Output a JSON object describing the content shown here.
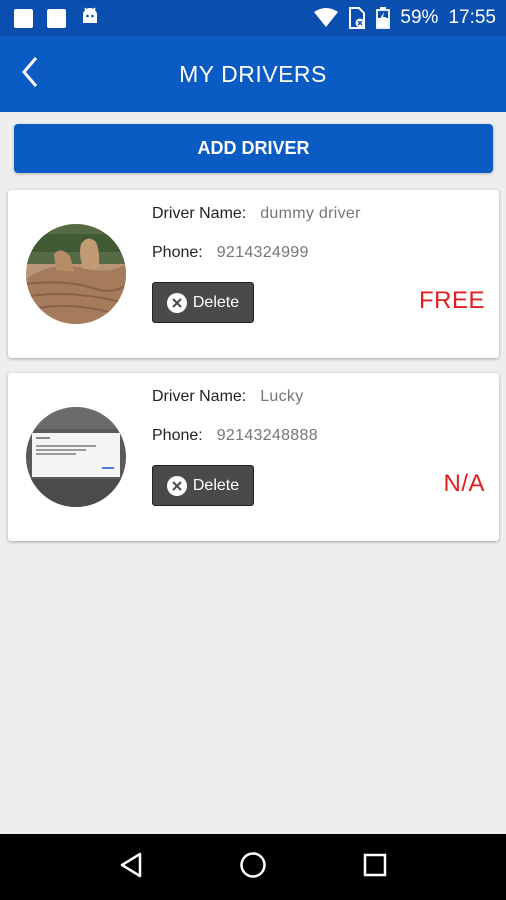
{
  "status_bar": {
    "battery": "59%",
    "time": "17:55",
    "icons": [
      "notification-square-icon",
      "notification-square-icon",
      "android-robot-icon",
      "wifi-icon",
      "sim-icon",
      "battery-icon"
    ]
  },
  "app_bar": {
    "title": "MY DRIVERS",
    "back_icon": "chevron-left-icon"
  },
  "add_button": {
    "label": "ADD DRIVER"
  },
  "drivers": [
    {
      "name_label": "Driver Name:",
      "name": "dummy driver",
      "phone_label": "Phone:",
      "phone": "9214324999",
      "delete_label": "Delete",
      "status": "FREE"
    },
    {
      "name_label": "Driver Name:",
      "name": "Lucky",
      "phone_label": "Phone:",
      "phone": "92143248888",
      "delete_label": "Delete",
      "status": "N/A"
    }
  ],
  "colors": {
    "primary": "#0a5bc4",
    "status_bar": "#0a4fb0",
    "status_text": "#e41e1e",
    "delete_button": "#4a4a4a"
  },
  "nav_bar": {
    "icons": [
      "back-triangle-icon",
      "home-circle-icon",
      "recents-square-icon"
    ]
  }
}
